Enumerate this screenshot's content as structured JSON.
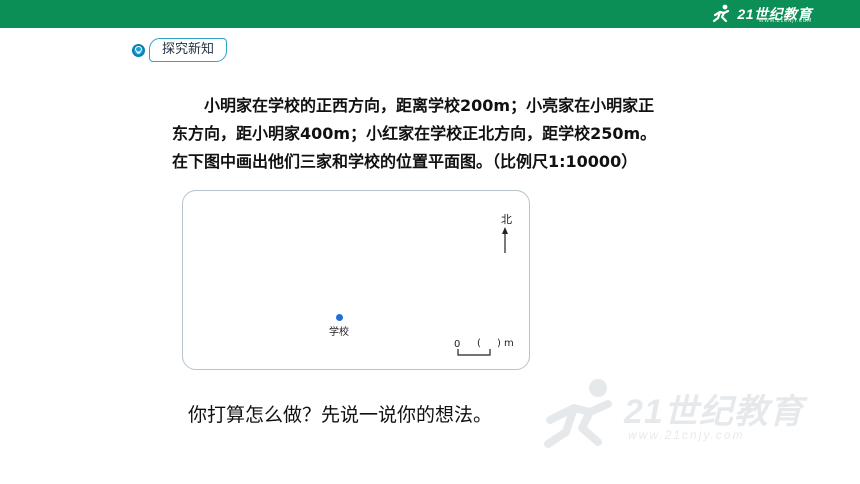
{
  "header": {
    "logo_text": "21世纪教育",
    "logo_url": "WWW.21CNJY.COM",
    "bar_color": "#0b8f57"
  },
  "section_tag": {
    "icon": "lightbulb-icon",
    "label": "探究新知"
  },
  "problem": {
    "line1": "小明家在学校的正西方向，距离学校200m；小亮家在小明家正",
    "line2": "东方向，距小明家400m；小红家在学校正北方向，距学校250m。",
    "line3": "在下图中画出他们三家和学校的位置平面图。（比例尺1:10000）"
  },
  "map": {
    "north_label": "北",
    "school_label": "学校",
    "scale_zero": "0",
    "scale_paren_left": "(",
    "scale_paren_right": ")",
    "scale_unit": "m",
    "dot_color": "#1e6fd9"
  },
  "question": "你打算怎么做？先说一说你的想法。",
  "watermark": {
    "text": "21世纪教育",
    "url": "www.21cnjy.com"
  }
}
